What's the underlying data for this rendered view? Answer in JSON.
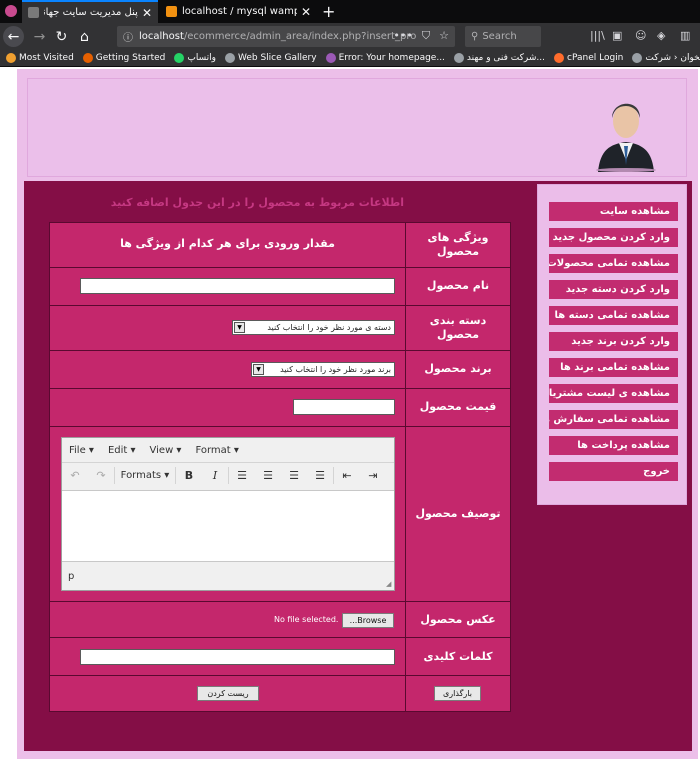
{
  "browser": {
    "tabs": [
      {
        "title": "پنل مدیریت سایت جهانگیر پچکم",
        "close": "✕"
      },
      {
        "title": "localhost / mysql wampserver | ph",
        "close": "✕"
      }
    ],
    "new_tab": "+",
    "url_host": "localhost",
    "url_path": "/ecommerce/admin_area/index.php?insert_pro",
    "search_placeholder": "Search",
    "bookmarks": [
      {
        "label": "Most Visited",
        "color": "#f0a030"
      },
      {
        "label": "Getting Started",
        "color": "#e66000"
      },
      {
        "label": "واتساپ",
        "color": "#25d366"
      },
      {
        "label": "Web Slice Gallery",
        "color": "#9aa0a6"
      },
      {
        "label": "Error: Your homepage...",
        "color": "#9b59b6"
      },
      {
        "label": "شرکت فنی و مهند...",
        "color": "#9aa0a6"
      },
      {
        "label": "cPanel Login",
        "color": "#ff6c2c"
      },
      {
        "label": "پیشخوان ‹ شرکت ...",
        "color": "#9aa0a6"
      }
    ]
  },
  "sidebar": {
    "items": [
      "مشاهده سایت",
      "وارد کردن محصول جدید",
      "مشاهده تمامی محصولات",
      "وارد کردن دسته جدید",
      "مشاهده تمامی دسته ها",
      "وارد کردن برند جدید",
      "مشاهده تمامی برند ها",
      "مشاهده ی لیست مشتریان",
      "مشاهده تمامی سفارش ها",
      "مشاهده پرداخت ها",
      "خروج"
    ]
  },
  "form": {
    "title": "اطلاعات مربوط به محصول را در این جدول اضافه کنید",
    "header_feature": "ویژگی های محصول",
    "header_value": "مقدار ورودی برای هر کدام از ویژگی ها",
    "product_name_label": "نام محصول",
    "category_label": "دسته بندی محصول",
    "category_select": "دسته ی مورد نظر خود را انتخاب کنید",
    "brand_label": "برند محصول",
    "brand_select": "برند مورد نظر خود را انتخاب کنید",
    "price_label": "قیمت محصول",
    "description_label": "توصیف محصول",
    "image_label": "عکس محصول",
    "browse_button": "...Browse",
    "no_file": "No file selected.",
    "keywords_label": "کلمات کلیدی",
    "upload_button": "بارگذاری",
    "reset_button": "ریست کردن"
  },
  "editor": {
    "menus": [
      "File ▾",
      "Edit ▾",
      "View ▾",
      "Format ▾"
    ],
    "formats": "Formats ▾",
    "status_path": "p"
  }
}
